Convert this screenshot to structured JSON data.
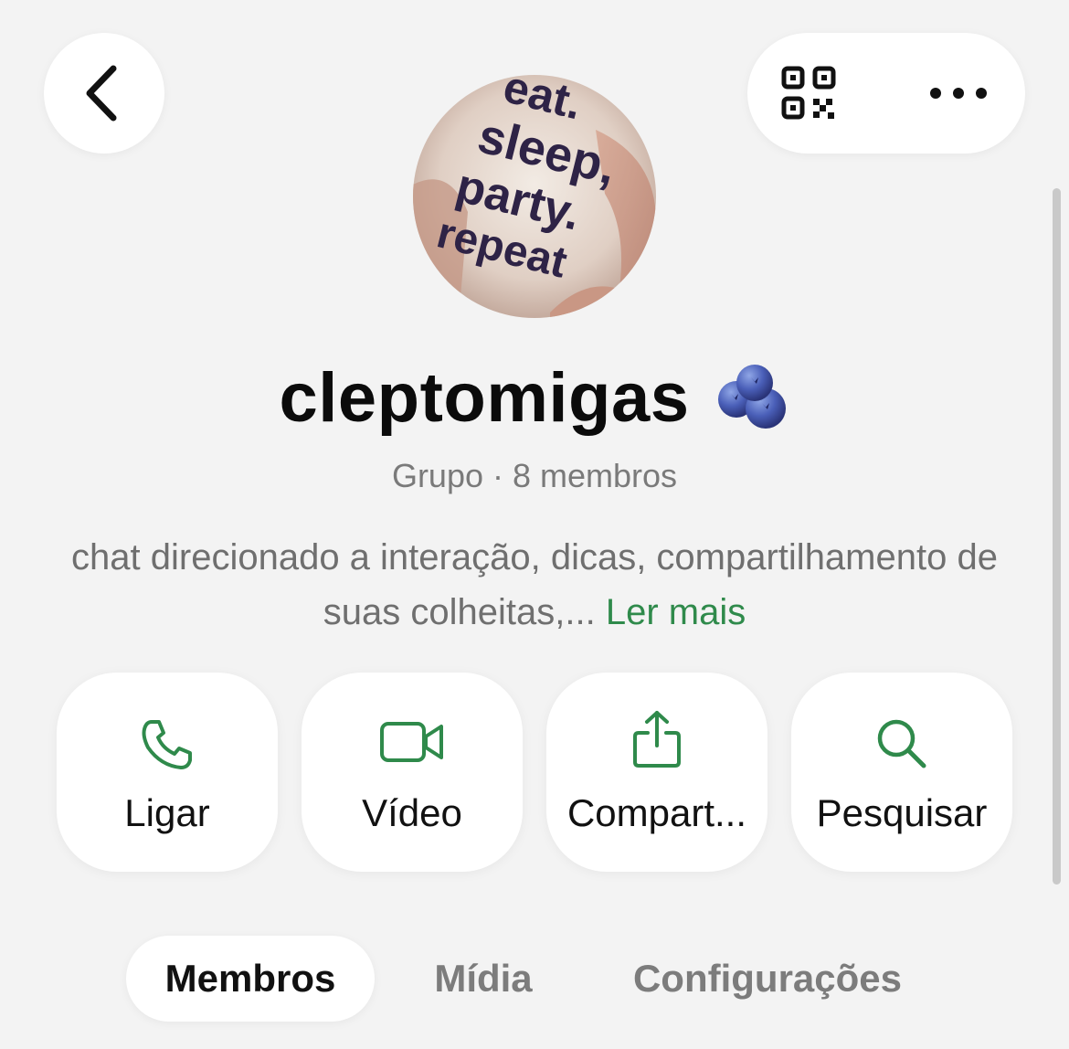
{
  "header": {
    "back_icon": "chevron-left-icon",
    "qr_icon": "qr-code-icon",
    "more_icon": "ellipsis-icon"
  },
  "group": {
    "name": "cleptomigas",
    "emoji": "blueberries-emoji",
    "subtitle": "Grupo · 8 membros",
    "avatar_text": [
      "eat.",
      "sleep,",
      "party.",
      "repeat"
    ],
    "description": "chat direcionado a interação, dicas, compartilhamento de suas colheitas,...",
    "read_more": "Ler mais"
  },
  "actions": [
    {
      "label": "Ligar",
      "icon": "phone-icon"
    },
    {
      "label": "Vídeo",
      "icon": "video-camera-icon"
    },
    {
      "label": "Compart...",
      "icon": "share-icon"
    },
    {
      "label": "Pesquisar",
      "icon": "search-icon"
    }
  ],
  "tabs": [
    {
      "label": "Membros",
      "active": true
    },
    {
      "label": "Mídia",
      "active": false
    },
    {
      "label": "Configurações",
      "active": false
    }
  ],
  "colors": {
    "accent": "#2f8a4b",
    "background": "#f3f3f3",
    "card": "#ffffff",
    "muted_text": "#6f6f6f"
  }
}
